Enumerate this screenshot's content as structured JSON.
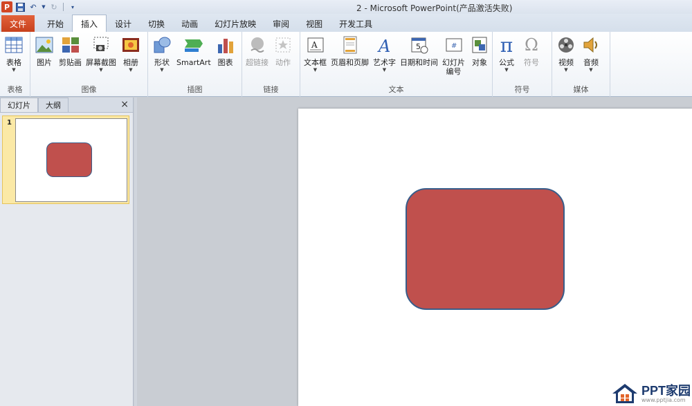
{
  "titlebar": {
    "app_logo": "P",
    "title": "2  -  Microsoft PowerPoint(产品激活失败)"
  },
  "tabs": {
    "file": "文件",
    "items": [
      "开始",
      "插入",
      "设计",
      "切换",
      "动画",
      "幻灯片放映",
      "审阅",
      "视图",
      "开发工具"
    ],
    "active": "插入"
  },
  "ribbon": {
    "groups": {
      "table": "表格",
      "images": "图像",
      "illustrations": "插图",
      "links": "链接",
      "text": "文本",
      "symbols": "符号",
      "media": "媒体"
    },
    "buttons": {
      "table": "表格",
      "picture": "图片",
      "clipart": "剪贴画",
      "screenshot": "屏幕截图",
      "album": "相册",
      "shapes": "形状",
      "smartart": "SmartArt",
      "chart": "图表",
      "hyperlink": "超链接",
      "action": "动作",
      "textbox": "文本框",
      "header_footer": "页眉和页脚",
      "wordart": "艺术字",
      "datetime": "日期和时间",
      "slide_number_1": "幻灯片",
      "slide_number_2": "编号",
      "object": "对象",
      "equation": "公式",
      "symbol": "符号",
      "video": "视频",
      "audio": "音频"
    }
  },
  "left_pane": {
    "tab_slides": "幻灯片",
    "tab_outline": "大纲",
    "close": "×",
    "slide_number": "1"
  },
  "watermark": {
    "brand": "PPT家园",
    "url": "www.pptjia.com"
  },
  "colors": {
    "shape_fill": "#c0504d",
    "shape_outline": "#385d8a",
    "file_tab": "#d24625",
    "slide_selected": "#fbe9a6"
  }
}
